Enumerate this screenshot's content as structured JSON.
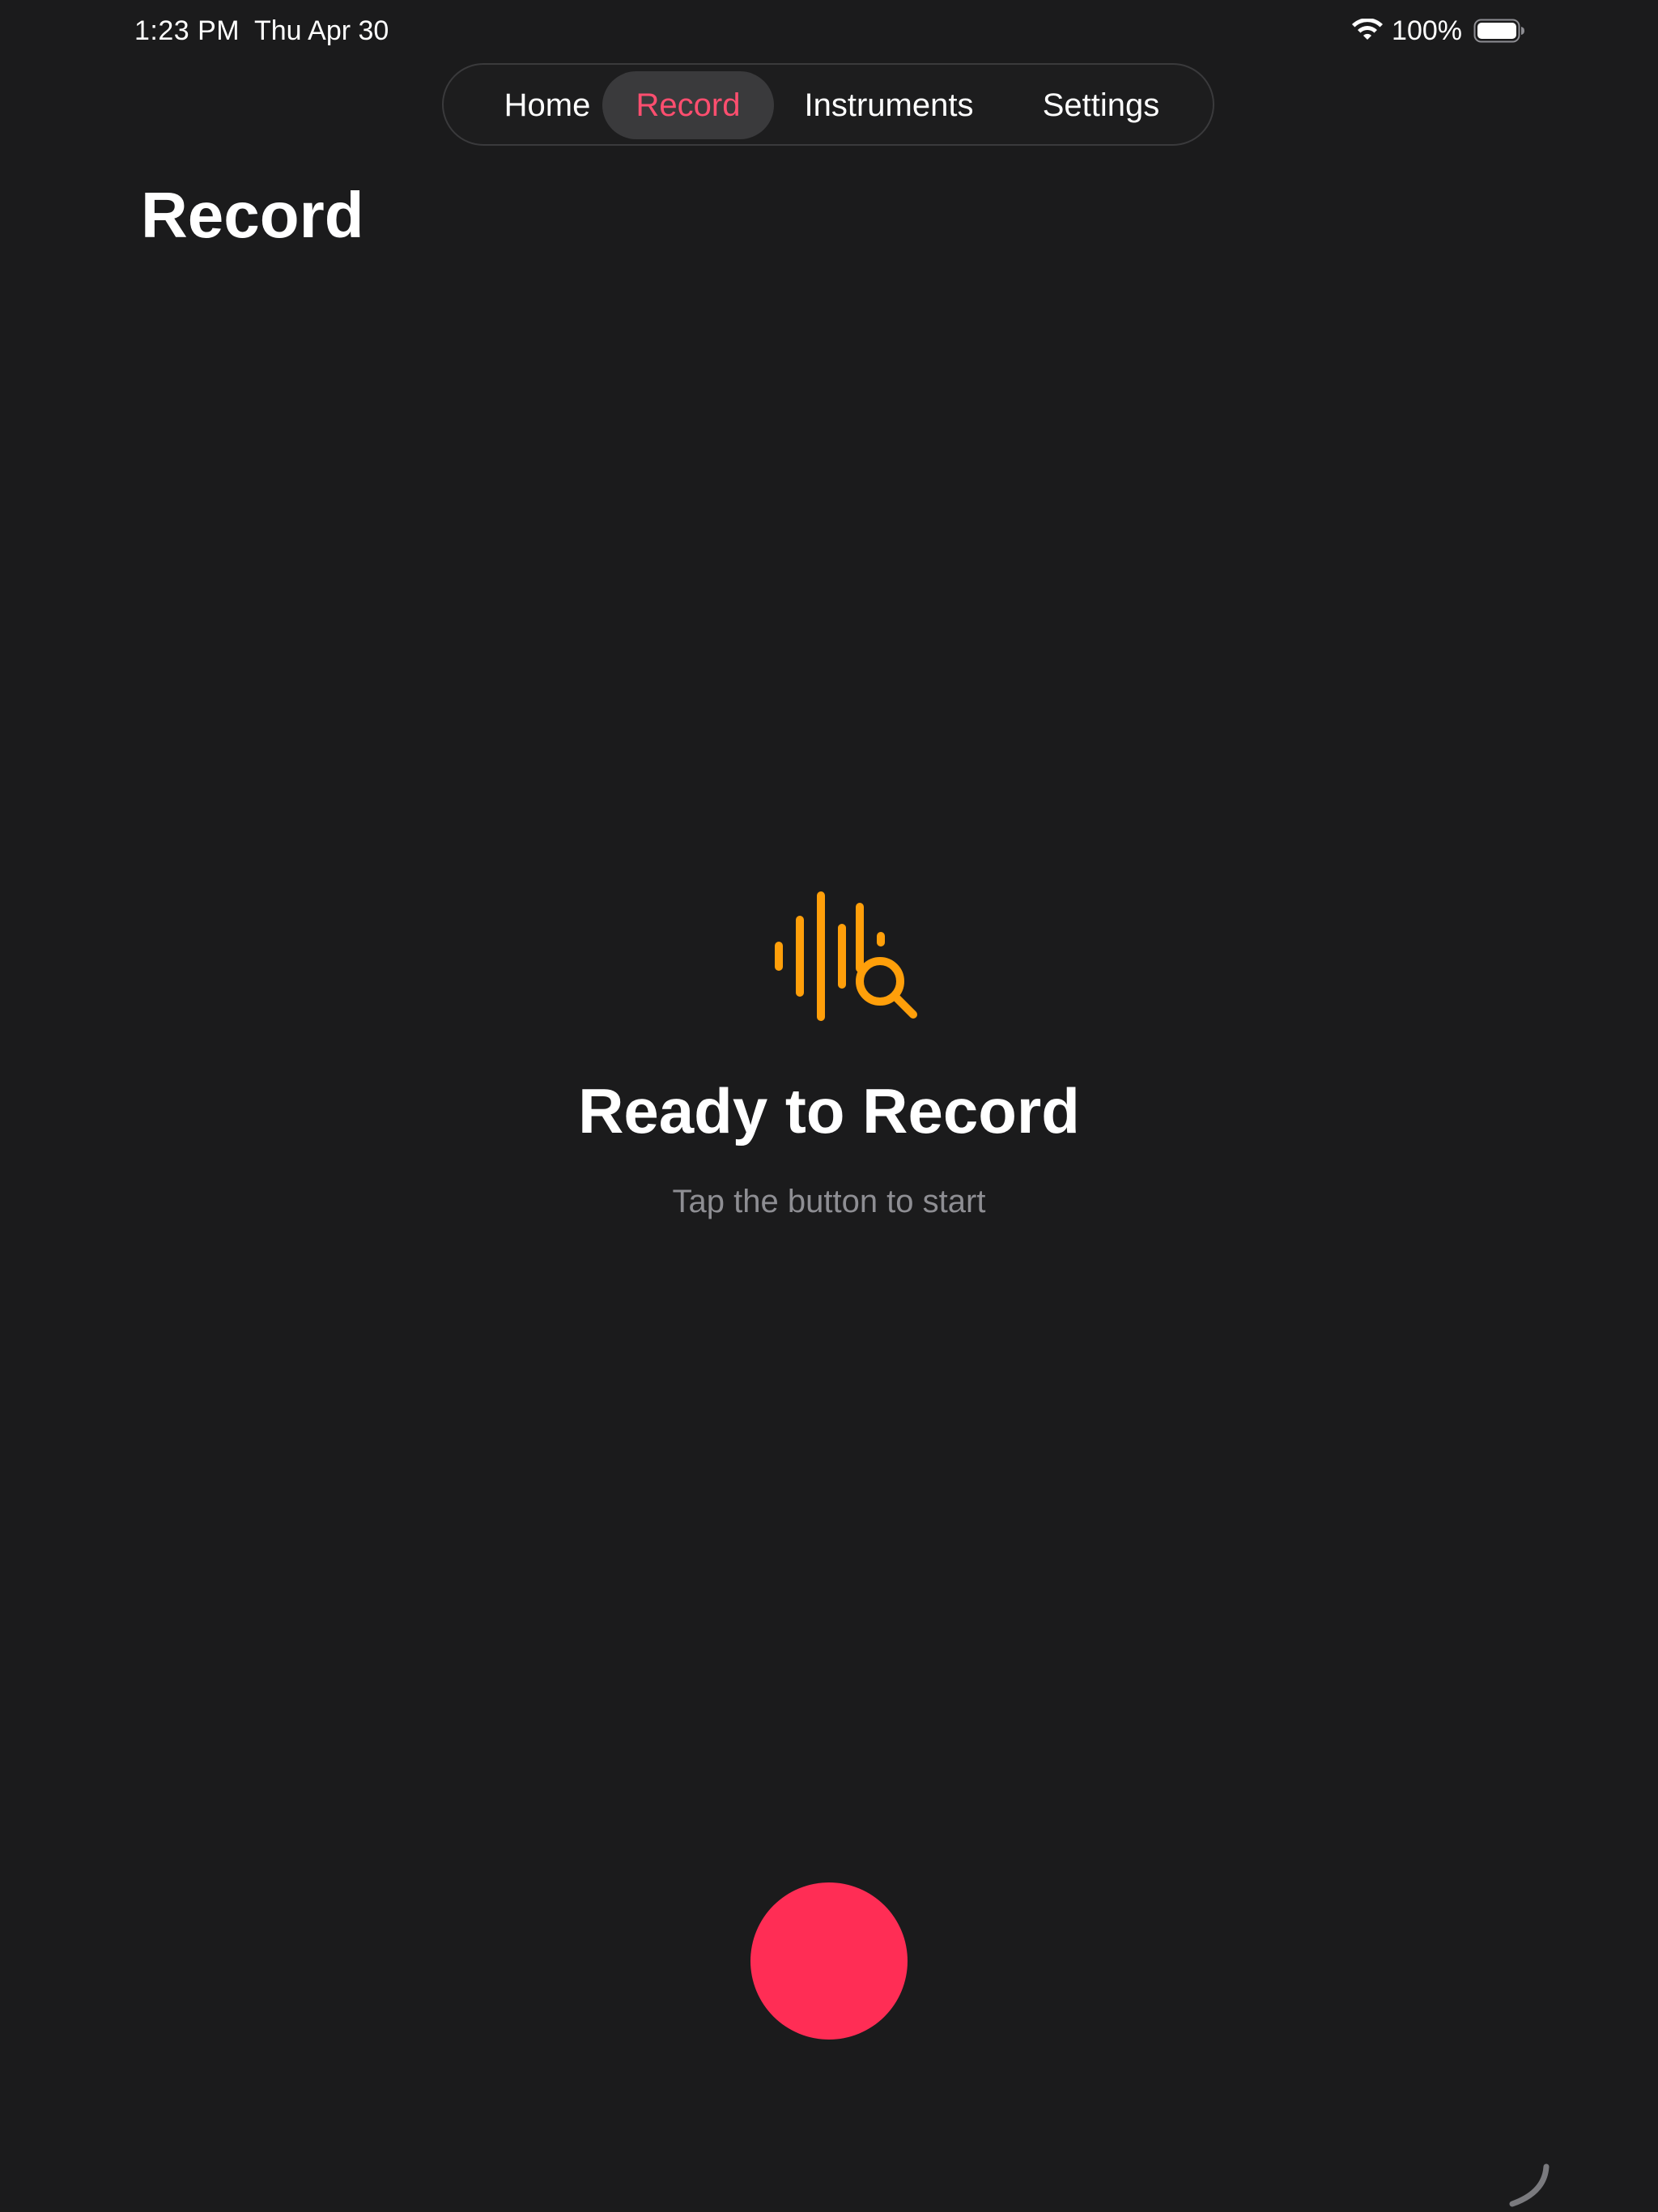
{
  "status_bar": {
    "time": "1:23 PM",
    "date": "Thu Apr 30",
    "battery_percent": "100%",
    "wifi_icon": "wifi-icon",
    "battery_icon": "battery-icon"
  },
  "tabs": [
    {
      "label": "Home",
      "selected": false
    },
    {
      "label": "Record",
      "selected": true
    },
    {
      "label": "Instruments",
      "selected": false
    },
    {
      "label": "Settings",
      "selected": false
    }
  ],
  "page": {
    "title": "Record"
  },
  "empty_state": {
    "icon": "waveform-magnifier-icon",
    "title": "Ready to Record",
    "subtitle": "Tap the button to start"
  },
  "record_button": {
    "icon": "record-icon"
  },
  "colors": {
    "background": "#1b1b1c",
    "accent_pink": "#ff4e6f",
    "record_red": "#ff2d55",
    "icon_orange": "#ff9f0a",
    "secondary_text": "#8e8e93",
    "selected_tab_bg": "#3a3a3c"
  }
}
